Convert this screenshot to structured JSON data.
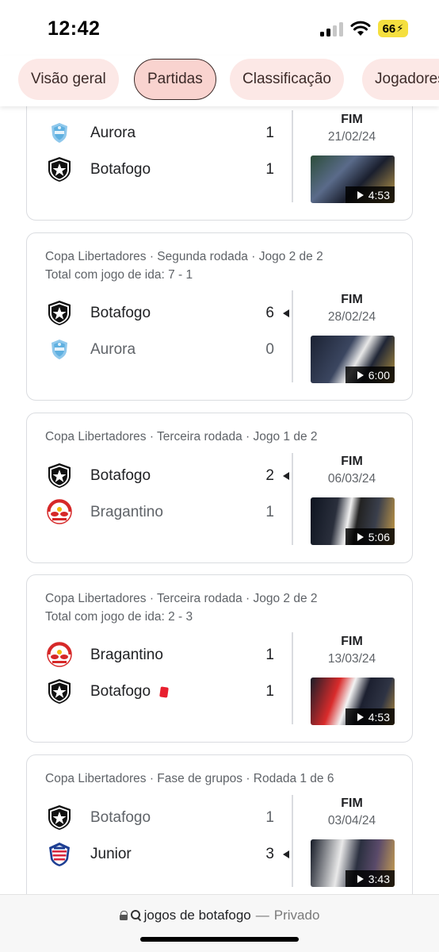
{
  "status_bar": {
    "time": "12:42",
    "battery": "66"
  },
  "tabs": [
    {
      "label": "Visão geral",
      "active": false
    },
    {
      "label": "Partidas",
      "active": true
    },
    {
      "label": "Classificação",
      "active": false
    },
    {
      "label": "Jogadores",
      "active": false
    }
  ],
  "matches": [
    {
      "header1": "",
      "header2": "",
      "team1": {
        "name": "Aurora",
        "score": "1",
        "logo": "aurora-logo",
        "winner": false
      },
      "team2": {
        "name": "Botafogo",
        "score": "1",
        "logo": "botafogo-logo",
        "winner": false
      },
      "status": "FIM",
      "date": "21/02/24",
      "duration": "4:53"
    },
    {
      "header1": "Copa Libertadores · Segunda rodada · Jogo 2 de 2",
      "header2": "Total com jogo de ida: 7 - 1",
      "team1": {
        "name": "Botafogo",
        "score": "6",
        "logo": "botafogo-logo",
        "winner": true
      },
      "team2": {
        "name": "Aurora",
        "score": "0",
        "logo": "aurora-logo",
        "winner": false
      },
      "status": "FIM",
      "date": "28/02/24",
      "duration": "6:00"
    },
    {
      "header1": "Copa Libertadores · Terceira rodada · Jogo 1 de 2",
      "header2": "",
      "team1": {
        "name": "Botafogo",
        "score": "2",
        "logo": "botafogo-logo",
        "winner": true
      },
      "team2": {
        "name": "Bragantino",
        "score": "1",
        "logo": "bragantino-logo",
        "winner": false
      },
      "status": "FIM",
      "date": "06/03/24",
      "duration": "5:06"
    },
    {
      "header1": "Copa Libertadores · Terceira rodada · Jogo 2 de 2",
      "header2": "Total com jogo de ida: 2 - 3",
      "team1": {
        "name": "Bragantino",
        "score": "1",
        "logo": "bragantino-logo",
        "winner": false
      },
      "team2": {
        "name": "Botafogo",
        "score": "1",
        "logo": "botafogo-logo",
        "winner": false,
        "red_card": true
      },
      "status": "FIM",
      "date": "13/03/24",
      "duration": "4:53"
    },
    {
      "header1": "Copa Libertadores · Fase de grupos · Rodada 1 de 6",
      "header2": "",
      "team1": {
        "name": "Botafogo",
        "score": "1",
        "logo": "botafogo-logo",
        "winner": false
      },
      "team2": {
        "name": "Junior",
        "score": "3",
        "logo": "junior-logo",
        "winner": true
      },
      "status": "FIM",
      "date": "03/04/24",
      "duration": "3:43"
    }
  ],
  "address_bar": {
    "query": "jogos de botafogo",
    "separator": "—",
    "mode": "Privado"
  },
  "colors": {
    "tab_bg": "#fce8e6",
    "tab_active_bg": "#f9d3cf",
    "red_card": "#e8202f",
    "battery": "#f5df3e"
  }
}
